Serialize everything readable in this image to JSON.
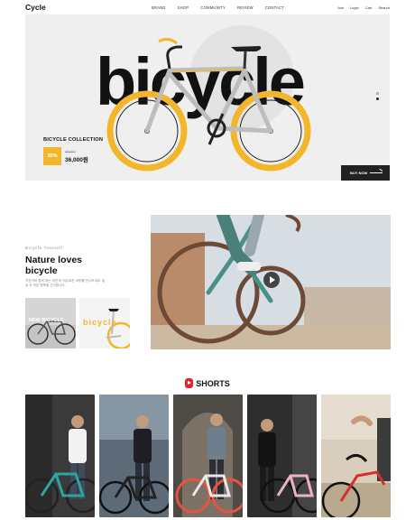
{
  "header": {
    "logo": "Cycle",
    "nav": [
      "BRAND",
      "SHOP",
      "COMMUNITY",
      "REVIEW",
      "CONTACT"
    ],
    "util": [
      "Join",
      "Login",
      "Cart",
      "Search"
    ]
  },
  "hero": {
    "word": "bicycle",
    "collection": "BICYCLE COLLECTION",
    "discount": "30%",
    "old_price": "48,000",
    "new_price": "36,000원",
    "buy_label": "BUY NOW",
    "slide_dots": 2,
    "active_dot": 1,
    "colors": {
      "bg": "#efefef",
      "wheel": "#f3b62a",
      "frame": "#c9c9c9"
    }
  },
  "feature": {
    "tag": "Bicycle Yourself",
    "title_line1": "Nature loves",
    "title_line2": "bicycle",
    "desc": "자전거와 함께 하는 자연 속 여유로운 하루를 만나보세요. 일상 속 작은 행복을 선사합니다.",
    "thumb1_label": "NEW BICYCLE",
    "thumb2_label": "bicycle",
    "play_icon": "play-icon"
  },
  "shorts": {
    "title": "SHORTS",
    "icon": "shorts-icon",
    "cards": [
      "short-1",
      "short-2",
      "short-3",
      "short-4",
      "short-5"
    ]
  }
}
